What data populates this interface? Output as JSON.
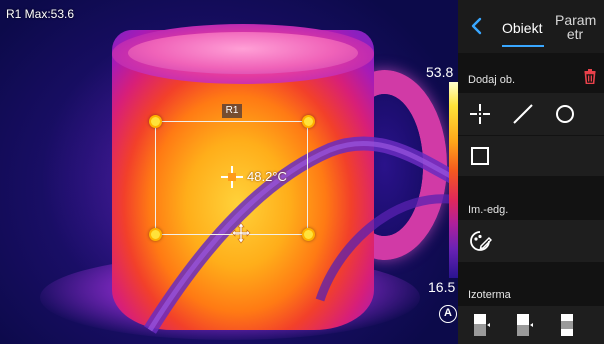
{
  "hud": {
    "roi_max": "R1 Max:53.6"
  },
  "roi": {
    "tag": "R1",
    "center_temp": "48.2°C"
  },
  "scale": {
    "max": "53.8",
    "min": "16.5",
    "auto_label": "A"
  },
  "panel": {
    "tabs": [
      {
        "label": "Obiekt"
      },
      {
        "label": "Param etr"
      }
    ],
    "add_object_label": "Dodaj ob.",
    "image_edit_label": "Im.-edg.",
    "isotherm_label": "Izoterma",
    "icons": {
      "back": "chevron-left-icon",
      "delete": "trash-icon",
      "point": "crosshair-point-icon",
      "line": "line-tool-icon",
      "circle": "circle-tool-icon",
      "rectangle": "rectangle-tool-icon",
      "edit": "image-edit-icon",
      "iso_above": "isotherm-above-icon",
      "iso_below": "isotherm-below-icon",
      "iso_interval": "isotherm-interval-icon"
    }
  },
  "colors": {
    "accent": "#39a7ff",
    "delete": "#e8414a",
    "handle": "#ffe23a"
  }
}
